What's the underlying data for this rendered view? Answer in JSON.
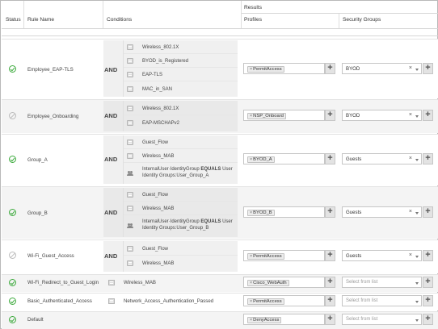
{
  "header": {
    "status": "Status",
    "rule_name": "Rule Name",
    "conditions": "Conditions",
    "results": "Results",
    "profiles": "Profiles",
    "security_groups": "Security Groups"
  },
  "colors": {
    "enabled": "#3aa93a",
    "disabled": "#bbbbbb",
    "and_panel": "#f0f0f0"
  },
  "rules": [
    {
      "status": "enabled",
      "name": "Employee_EAP-TLS",
      "operator": "AND",
      "conditions": [
        {
          "icon": "condition-icon",
          "text": "Wireless_802.1X"
        },
        {
          "icon": "condition-icon",
          "text": "BYOD_is_Registered"
        },
        {
          "icon": "condition-icon",
          "text": "EAP-TLS"
        },
        {
          "icon": "condition-icon",
          "text": "MAC_in_SAN"
        }
      ],
      "profile": "PermitAccess",
      "security_group": "BYOD"
    },
    {
      "status": "disabled",
      "name": "Employee_Onboarding",
      "operator": "AND",
      "conditions": [
        {
          "icon": "condition-icon",
          "text": "Wireless_802.1X"
        },
        {
          "icon": "condition-icon",
          "text": "EAP-MSCHAPv2"
        }
      ],
      "profile": "NSP_Onboard",
      "security_group": "BYOD"
    },
    {
      "status": "enabled",
      "name": "Group_A",
      "operator": "AND",
      "conditions": [
        {
          "icon": "condition-icon",
          "text": "Guest_Flow"
        },
        {
          "icon": "condition-icon",
          "text": "Wireless_MAB"
        },
        {
          "icon": "identity-group-icon",
          "pre": "InternalUser·IdentityGroup",
          "op": "EQUALS",
          "post": "User",
          "line2": "Identity Groups:User_Group_A"
        }
      ],
      "profile": "BYOD_A",
      "security_group": "Guests"
    },
    {
      "status": "enabled",
      "name": "Group_B",
      "operator": "AND",
      "conditions": [
        {
          "icon": "condition-icon",
          "text": "Guest_Flow"
        },
        {
          "icon": "condition-icon",
          "text": "Wireless_MAB"
        },
        {
          "icon": "identity-group-icon",
          "pre": "InternalUser·IdentityGroup",
          "op": "EQUALS",
          "post": "User",
          "line2": "Identity Groups:User_Group_B"
        }
      ],
      "profile": "BYOD_B",
      "security_group": "Guests"
    },
    {
      "status": "disabled",
      "name": "Wi-Fi_Guest_Access",
      "operator": "AND",
      "conditions": [
        {
          "icon": "condition-icon",
          "text": "Guest_Flow"
        },
        {
          "icon": "condition-icon",
          "text": "Wireless_MAB"
        }
      ],
      "profile": "PermitAccess",
      "security_group": "Guests"
    },
    {
      "status": "enabled",
      "name": "Wi-Fi_Redirect_to_Guest_Login",
      "condition_single": "Wireless_MAB",
      "profile": "Cisco_WebAuth",
      "security_group_placeholder": "Select from list"
    },
    {
      "status": "enabled",
      "name": "Basic_Authenticated_Access",
      "condition_single": "Network_Access_Authentication_Passed",
      "profile": "PermitAccess",
      "security_group_placeholder": "Select from list"
    },
    {
      "status": "enabled",
      "name": "Default",
      "profile": "DenyAccess",
      "security_group_placeholder": "Select from list"
    }
  ]
}
